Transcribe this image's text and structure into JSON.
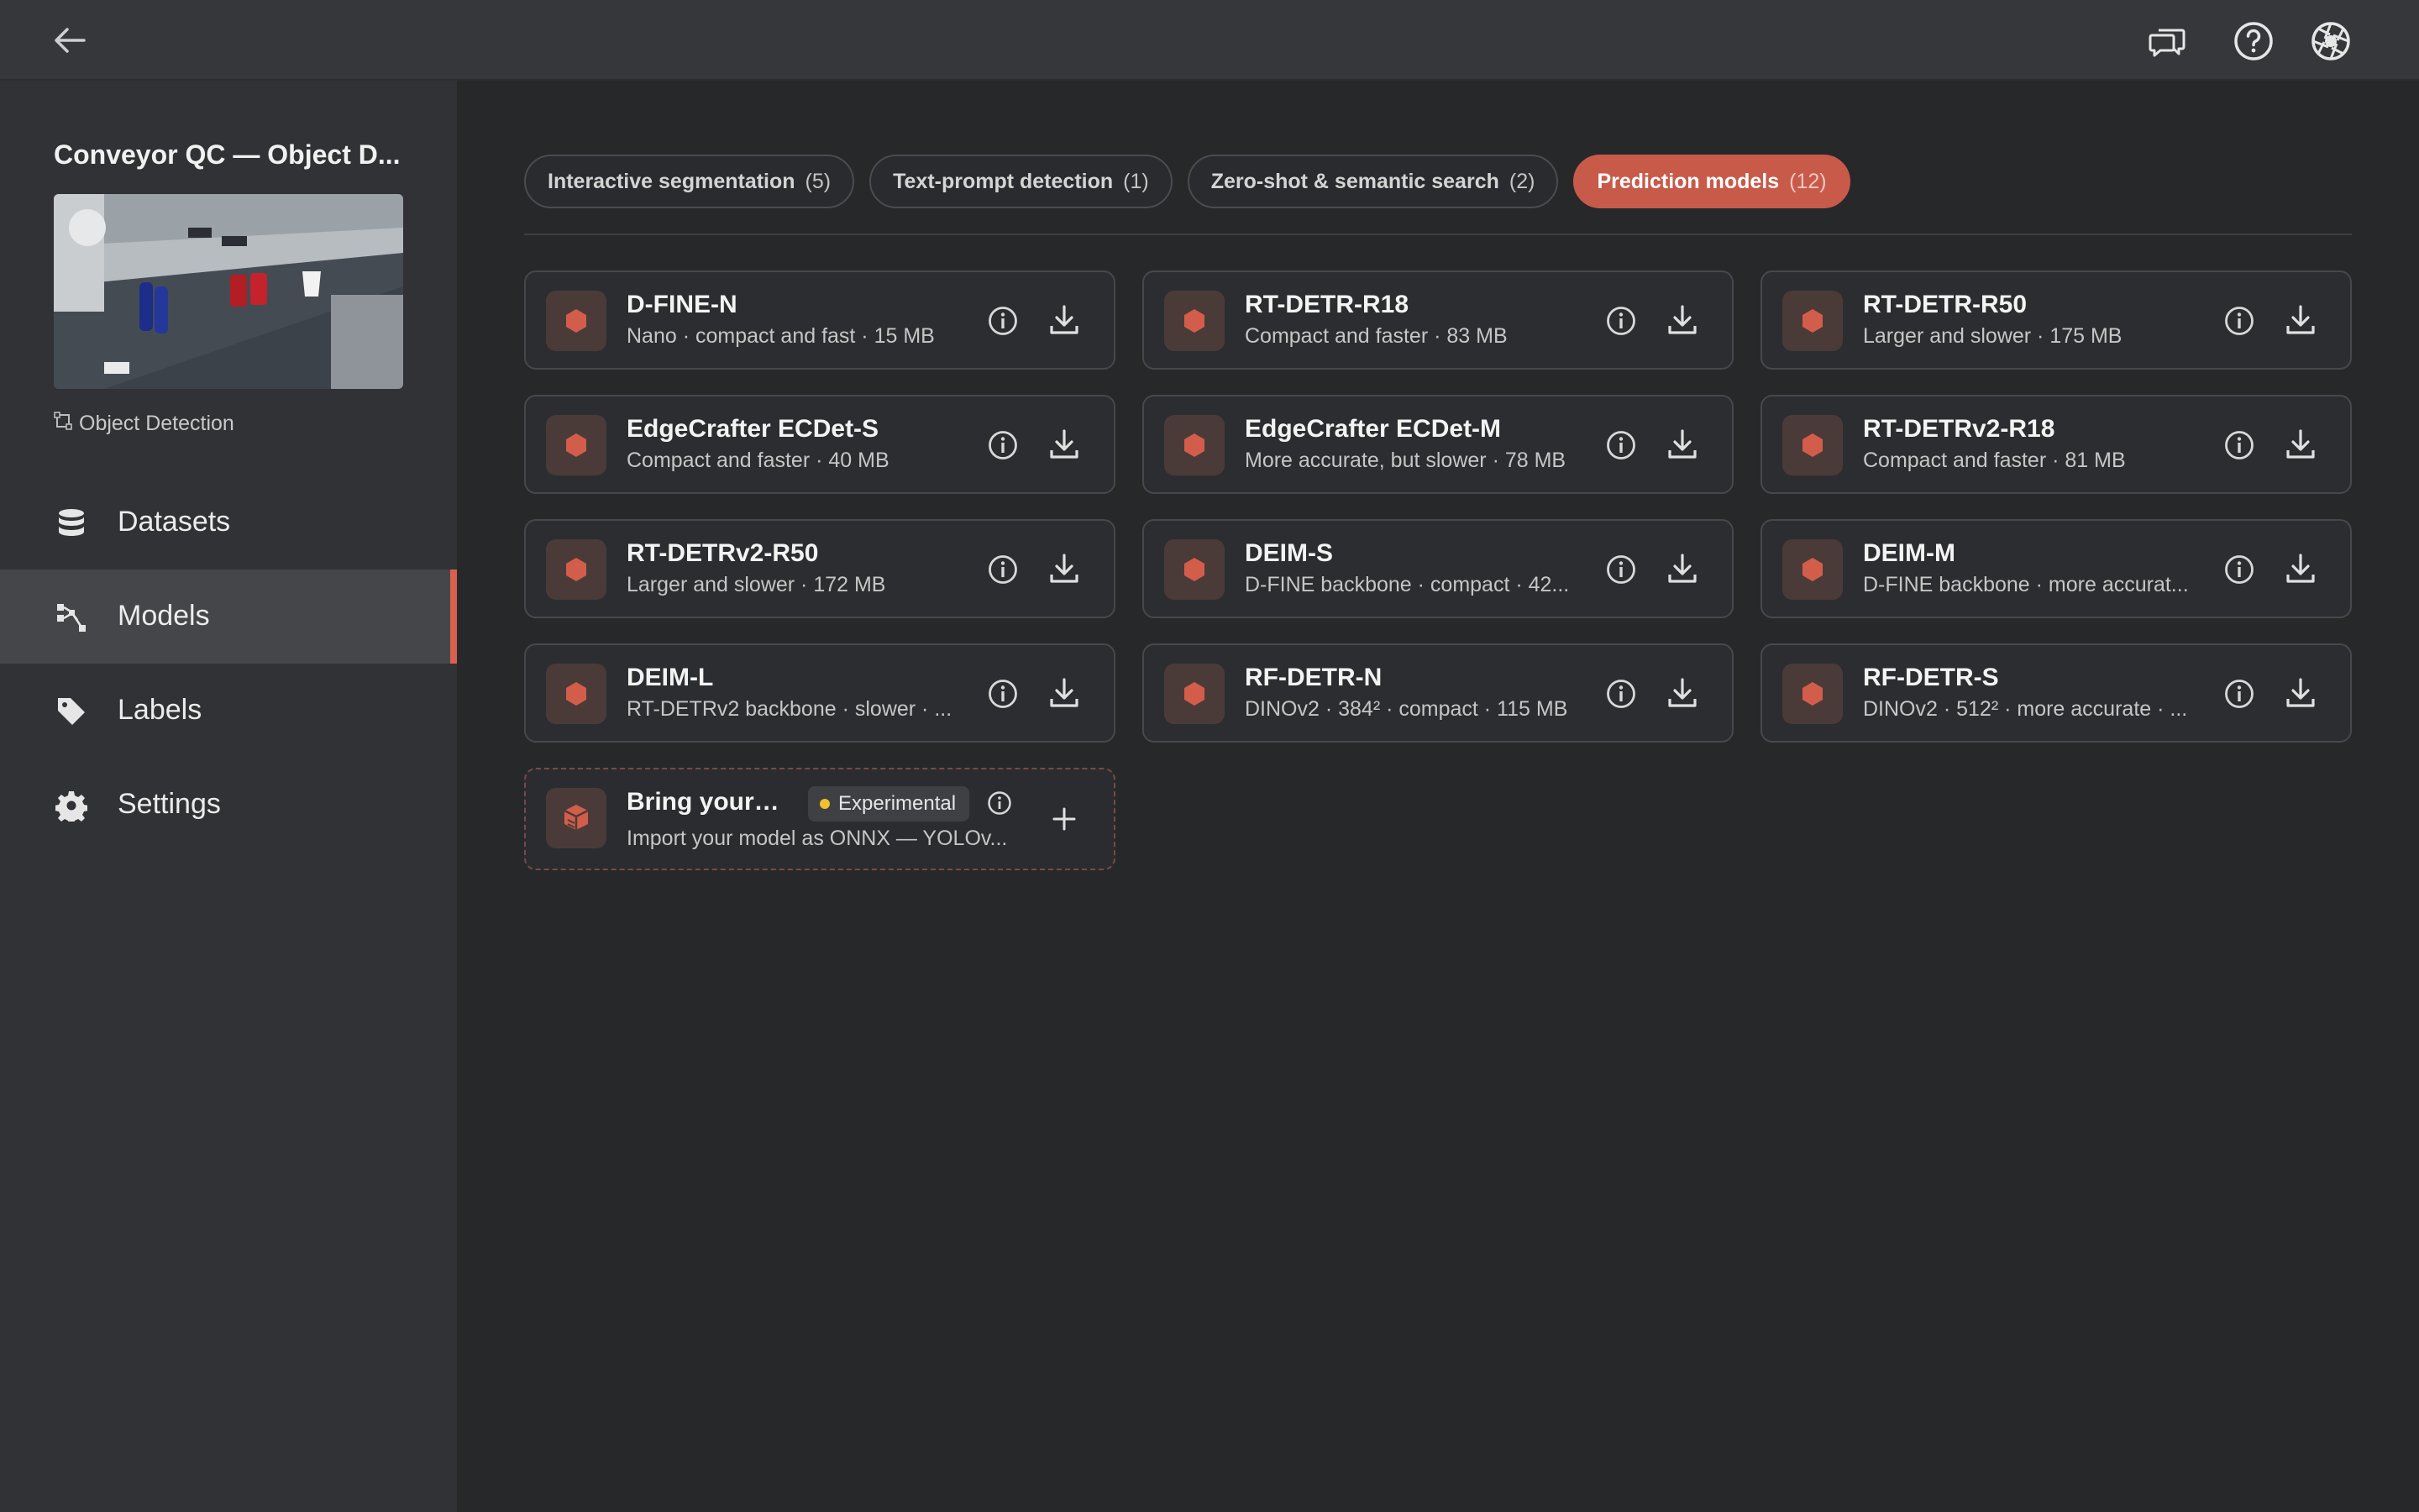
{
  "project": {
    "title": "Conveyor QC — Object D...",
    "type_label": "Object Detection"
  },
  "nav": {
    "items": [
      {
        "label": "Datasets",
        "icon": "database-icon",
        "active": false
      },
      {
        "label": "Models",
        "icon": "model-graph-icon",
        "active": true
      },
      {
        "label": "Labels",
        "icon": "tag-icon",
        "active": false
      },
      {
        "label": "Settings",
        "icon": "gear-icon",
        "active": false
      }
    ]
  },
  "topbar": {
    "icons": [
      "back-arrow-icon",
      "chat-bubbles-icon",
      "help-icon",
      "aperture-icon"
    ]
  },
  "tabs": [
    {
      "label": "Interactive segmentation",
      "count": "(5)",
      "active": false
    },
    {
      "label": "Text-prompt detection",
      "count": "(1)",
      "active": false
    },
    {
      "label": "Zero-shot & semantic search",
      "count": "(2)",
      "active": false
    },
    {
      "label": "Prediction models",
      "count": "(12)",
      "active": true
    }
  ],
  "models": [
    {
      "name": "D-FINE-N",
      "desc": "Nano · compact and fast · 15 MB"
    },
    {
      "name": "RT-DETR-R18",
      "desc": "Compact and faster · 83 MB"
    },
    {
      "name": "RT-DETR-R50",
      "desc": "Larger and slower · 175 MB"
    },
    {
      "name": "EdgeCrafter ECDet-S",
      "desc": "Compact and faster · 40 MB"
    },
    {
      "name": "EdgeCrafter ECDet-M",
      "desc": "More accurate, but slower · 78 MB"
    },
    {
      "name": "RT-DETRv2-R18",
      "desc": "Compact and faster · 81 MB"
    },
    {
      "name": "RT-DETRv2-R50",
      "desc": "Larger and slower · 172 MB"
    },
    {
      "name": "DEIM-S",
      "desc": "D-FINE backbone · compact · 42..."
    },
    {
      "name": "DEIM-M",
      "desc": "D-FINE backbone · more accurat..."
    },
    {
      "name": "DEIM-L",
      "desc": "RT-DETRv2 backbone · slower · ..."
    },
    {
      "name": "RF-DETR-N",
      "desc": "DINOv2 · 384² · compact · 115 MB"
    },
    {
      "name": "RF-DETR-S",
      "desc": "DINOv2 · 512² · more accurate · ..."
    }
  ],
  "byo": {
    "name": "Bring your o...",
    "badge": "Experimental",
    "desc": "Import your model as ONNX — YOLOv..."
  },
  "colors": {
    "accent": "#c85a4a",
    "badge_dot": "#f0c12c"
  }
}
